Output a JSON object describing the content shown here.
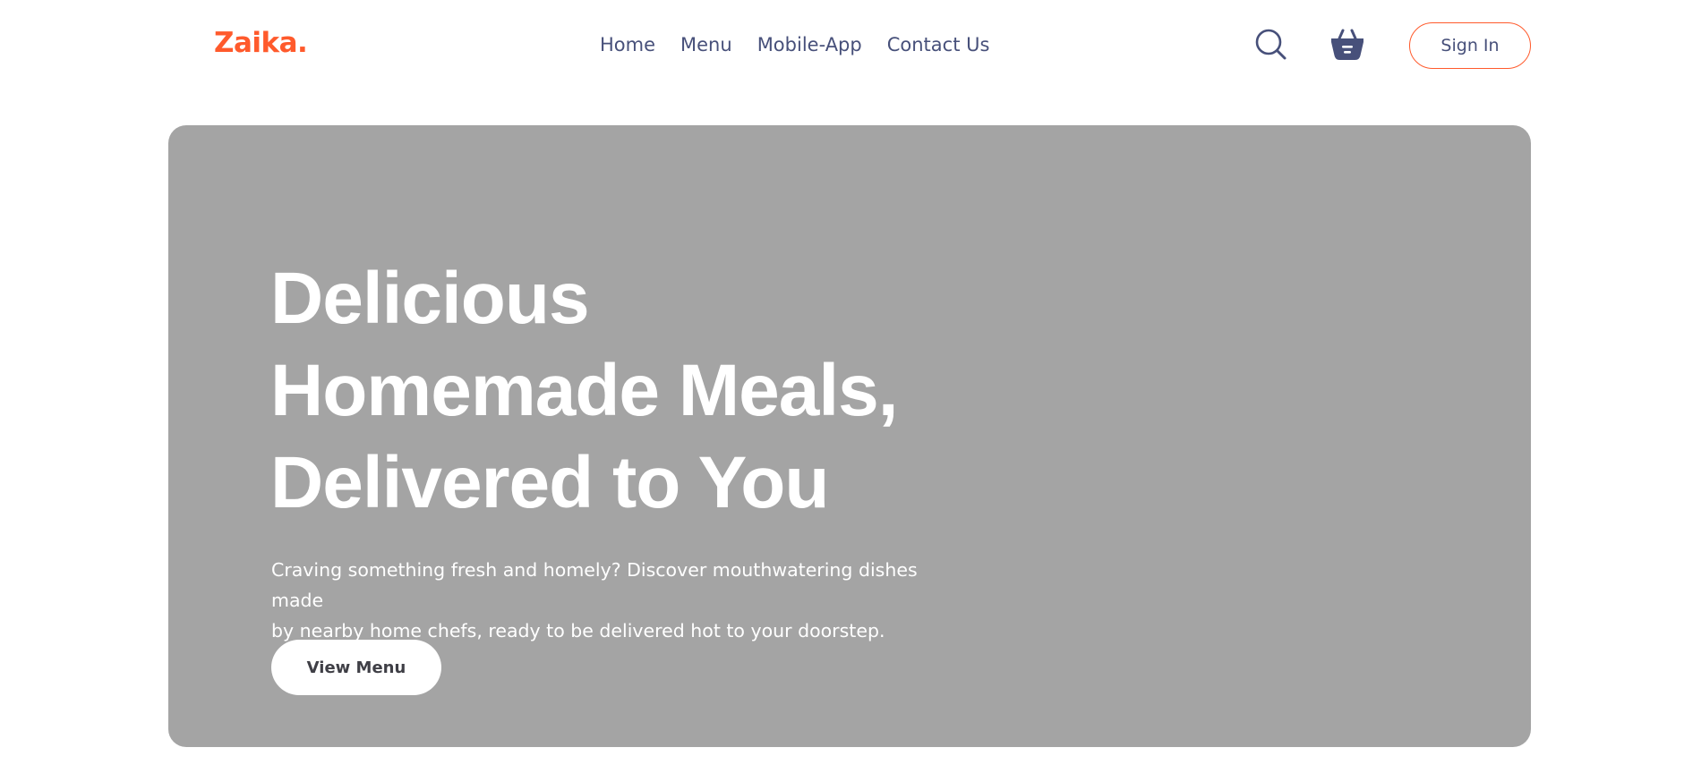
{
  "brand": {
    "logo_text": "Zaika.",
    "accent_color": "#ff5a2c",
    "text_color": "#47507a"
  },
  "nav": {
    "links": [
      {
        "label": "Home"
      },
      {
        "label": "Menu"
      },
      {
        "label": "Mobile-App"
      },
      {
        "label": "Contact Us"
      }
    ],
    "search_icon": "search-icon",
    "basket_icon": "basket-icon",
    "signin_label": "Sign In"
  },
  "hero": {
    "title_lines": [
      "Delicious",
      "Homemade Meals,",
      "Delivered to You"
    ],
    "description_lines": [
      "Craving something fresh and homely? Discover mouthwatering dishes made",
      "by nearby home chefs, ready to be delivered hot to your doorstep."
    ],
    "cta_label": "View Menu",
    "background_color": "#a4a4a4"
  }
}
